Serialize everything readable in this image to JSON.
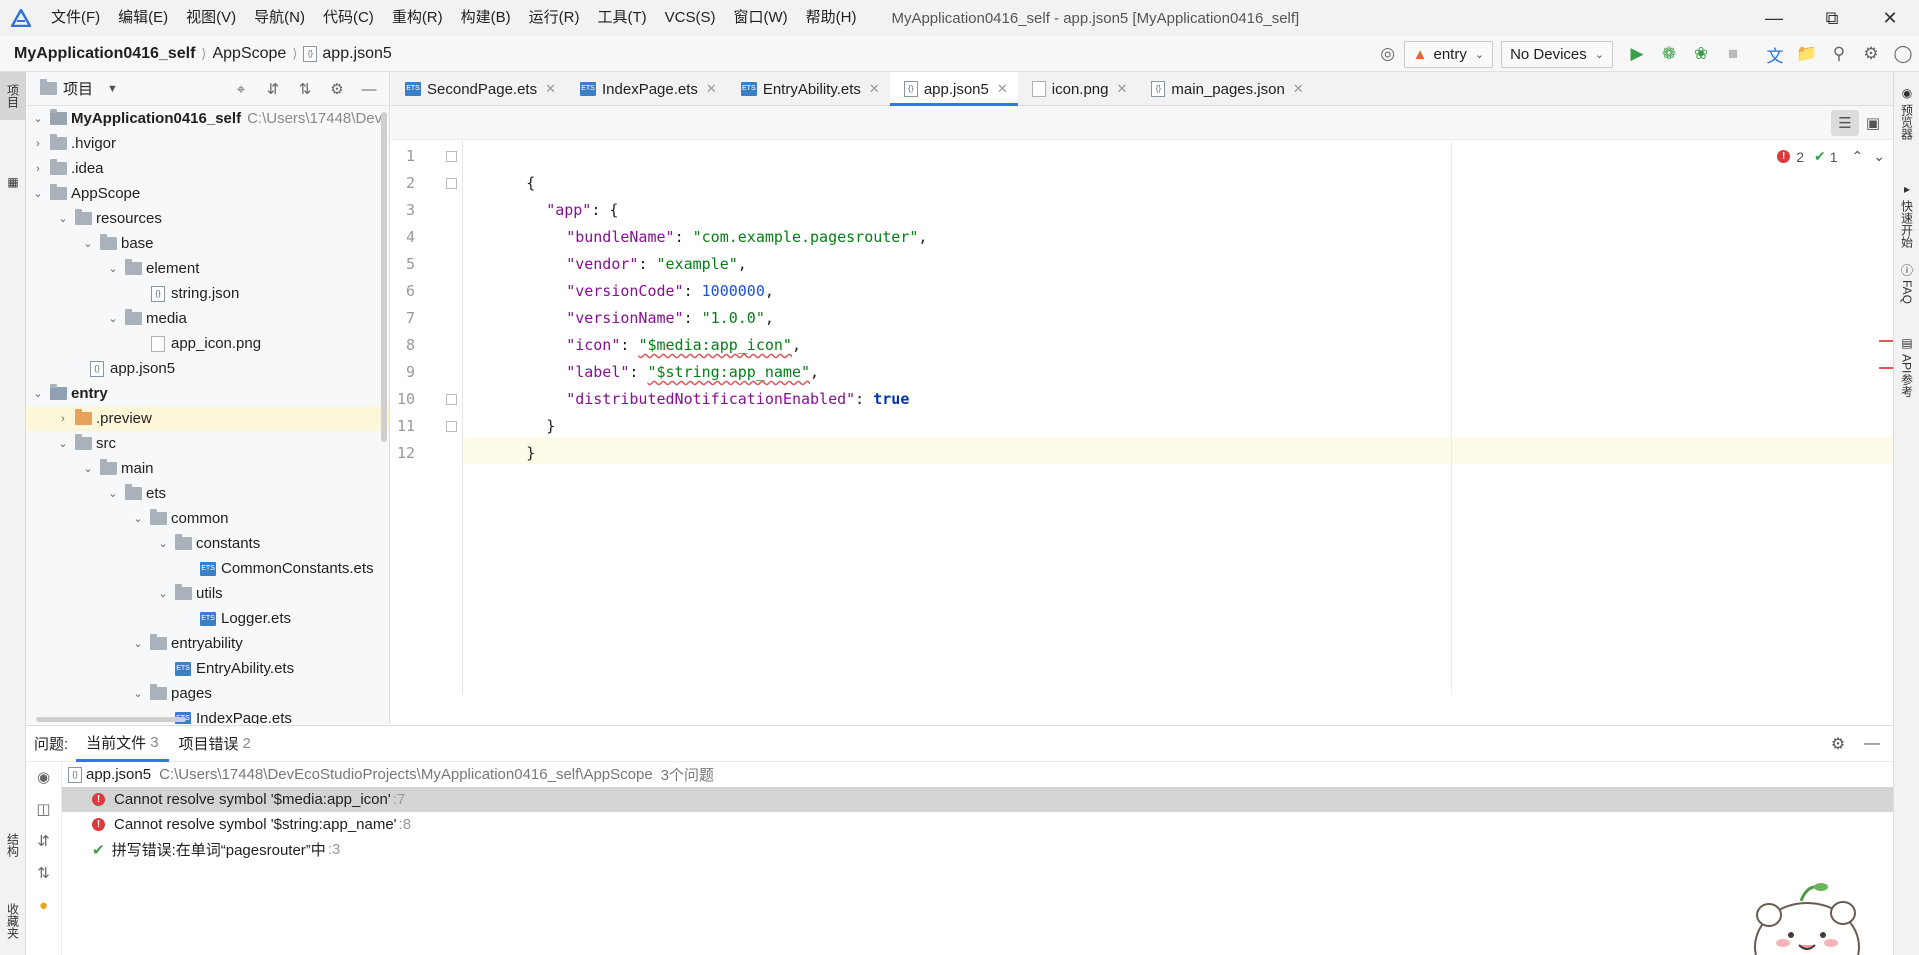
{
  "menubar": {
    "items": [
      "文件(F)",
      "编辑(E)",
      "视图(V)",
      "导航(N)",
      "代码(C)",
      "重构(R)",
      "构建(B)",
      "运行(R)",
      "工具(T)",
      "VCS(S)",
      "窗口(W)",
      "帮助(H)"
    ],
    "window_title": "MyApplication0416_self - app.json5 [MyApplication0416_self]"
  },
  "navbar": {
    "breadcrumb": [
      "MyApplication0416_self",
      "AppScope",
      "app.json5"
    ],
    "run_config": "entry",
    "device": "No Devices"
  },
  "left_stripe": {
    "project_tab": "项目",
    "structure_tab": "结构",
    "favorites_tab": "收藏夹"
  },
  "right_stripe": {
    "tabs": [
      "预览器",
      "快速开始",
      "FAQ",
      "API参考"
    ]
  },
  "project_panel": {
    "title": "项目",
    "tree": [
      {
        "label": "MyApplication0416_self",
        "path": "C:\\Users\\17448\\Dev"
      },
      {
        "label": ".hvigor"
      },
      {
        "label": ".idea"
      },
      {
        "label": "AppScope"
      },
      {
        "label": "resources"
      },
      {
        "label": "base"
      },
      {
        "label": "element"
      },
      {
        "label": "string.json"
      },
      {
        "label": "media"
      },
      {
        "label": "app_icon.png"
      },
      {
        "label": "app.json5"
      },
      {
        "label": "entry"
      },
      {
        "label": ".preview"
      },
      {
        "label": "src"
      },
      {
        "label": "main"
      },
      {
        "label": "ets"
      },
      {
        "label": "common"
      },
      {
        "label": "constants"
      },
      {
        "label": "CommonConstants.ets"
      },
      {
        "label": "utils"
      },
      {
        "label": "Logger.ets"
      },
      {
        "label": "entryability"
      },
      {
        "label": "EntryAbility.ets"
      },
      {
        "label": "pages"
      },
      {
        "label": "IndexPage.ets"
      }
    ]
  },
  "editor_tabs": [
    "SecondPage.ets",
    "IndexPage.ets",
    "EntryAbility.ets",
    "app.json5",
    "icon.png",
    "main_pages.json"
  ],
  "editor": {
    "line_numbers": [
      "1",
      "2",
      "3",
      "4",
      "5",
      "6",
      "7",
      "8",
      "9",
      "10",
      "11",
      "12"
    ],
    "tokens": {
      "open": "{",
      "app_key": "\"app\"",
      "colon_brace": ": {",
      "bundle_key": "\"bundleName\"",
      "bundle_val": "\"com.example.pagesrouter\"",
      "vendor_key": "\"vendor\"",
      "vendor_val": "\"example\"",
      "vcode_key": "\"versionCode\"",
      "vcode_val": "1000000",
      "vname_key": "\"versionName\"",
      "vname_val": "\"1.0.0\"",
      "icon_key": "\"icon\"",
      "icon_val": "\"$media:app_icon\"",
      "label_key": "\"label\"",
      "label_val": "\"$string:app_name\"",
      "dne_key": "\"distributedNotificationEnabled\"",
      "dne_val": "true",
      "colon": ": ",
      "comma": ",",
      "close_inner": "}",
      "close_outer": "}"
    },
    "inspection": {
      "errors": "2",
      "typos": "1"
    }
  },
  "problems": {
    "label": "问题:",
    "tabs": [
      {
        "label": "当前文件",
        "count": "3"
      },
      {
        "label": "项目错误",
        "count": "2"
      }
    ],
    "file": {
      "name": "app.json5",
      "path": "C:\\Users\\17448\\DevEcoStudioProjects\\MyApplication0416_self\\AppScope",
      "count": "3个问题"
    },
    "items": [
      {
        "text": "Cannot resolve symbol '$media:app_icon'",
        "line": ":7"
      },
      {
        "text": "Cannot resolve symbol '$string:app_name'",
        "line": ":8"
      },
      {
        "text": "拼写错误:在单词“pagesrouter”中",
        "line": ":3"
      }
    ]
  },
  "colors": {
    "accent": "#3574f0",
    "error": "#db3b3b",
    "string": "#067d17",
    "keyword": "#871094",
    "number": "#1750eb"
  }
}
